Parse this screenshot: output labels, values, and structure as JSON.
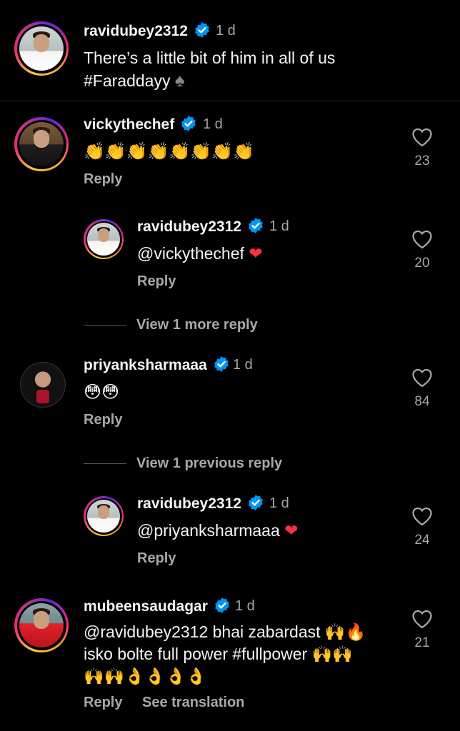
{
  "caption": {
    "username": "ravidubey2312",
    "time": "1 d",
    "text_line1": "There’s a little bit of him in all of us",
    "text_line2": "#Faraddayy",
    "spade": "♠"
  },
  "comments": [
    {
      "username": "vickythechef",
      "time": "1 d",
      "text": "👏👏👏👏👏👏👏👏",
      "likes": "23",
      "reply_label": "Reply"
    },
    {
      "username": "ravidubey2312",
      "time": "1 d",
      "text": "@vickythechef",
      "heart": "❤",
      "likes": "20",
      "reply_label": "Reply"
    },
    {
      "username": "priyanksharmaaa",
      "time": "1 d",
      "text": "😳😳",
      "likes": "84",
      "reply_label": "Reply"
    },
    {
      "username": "ravidubey2312",
      "time": "1 d",
      "text": "@priyanksharmaaa",
      "heart": "❤",
      "likes": "24",
      "reply_label": "Reply"
    },
    {
      "username": "mubeensaudagar",
      "time": "1 d",
      "text_line1": "@ravidubey2312 bhai zabardast 🙌🔥",
      "text_line2": "isko bolte full power #fullpower 🙌🙌",
      "text_line3": "🙌🙌👌👌👌👌",
      "likes": "21",
      "reply_label": "Reply",
      "translate_label": "See translation"
    }
  ],
  "view_more_replies": "View 1 more reply",
  "view_previous_reply": "View 1 previous reply"
}
